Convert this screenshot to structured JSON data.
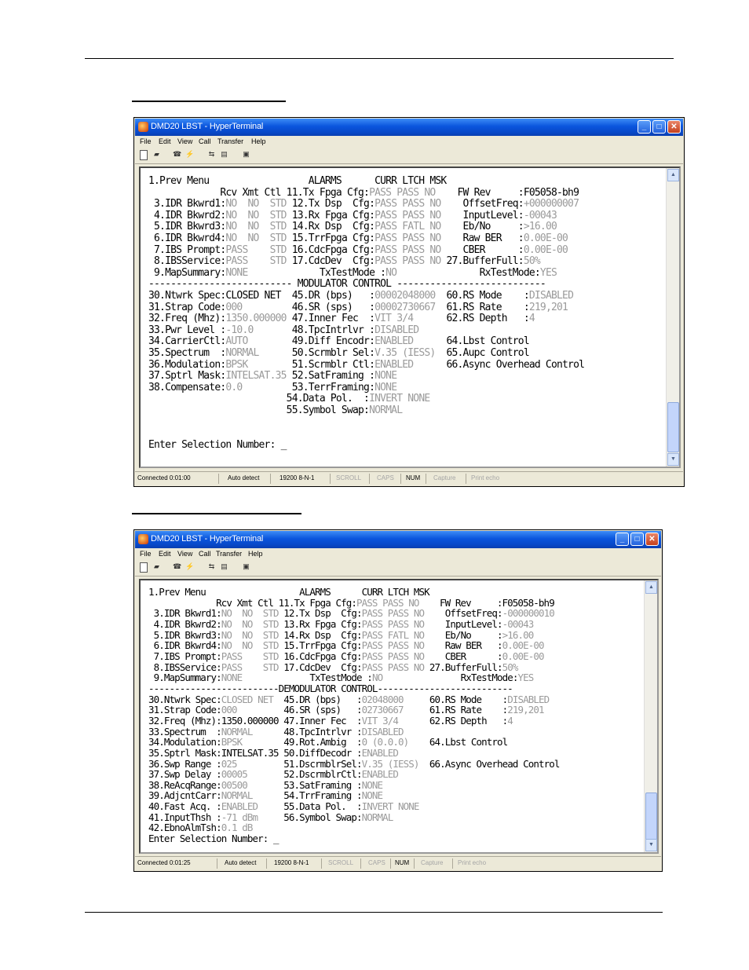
{
  "window1": {
    "title": "DMD20 LBST - HyperTerminal",
    "menu": [
      "File",
      "Edit",
      "View",
      "Call",
      "Transfer",
      "Help"
    ],
    "status": [
      "Connected 0:01:00",
      "Auto detect",
      "19200 8-N-1",
      "SCROLL",
      "CAPS",
      "NUM",
      "Capture",
      "Print echo"
    ],
    "lines": [
      [
        [
          "1.Prev Menu                  ALARMS      CURR LTCH MSK",
          ""
        ]
      ],
      [
        [
          "             Rcv Xmt Ctl 11.Tx Fpga Cfg:",
          ""
        ],
        [
          "PASS PASS NO",
          "d"
        ],
        [
          "    FW Rev     :F05058-bh9",
          ""
        ]
      ],
      [
        [
          " 3.IDR Bkwrd1:",
          ""
        ],
        [
          "NO  NO  STD",
          "d"
        ],
        [
          " 12.Tx Dsp  Cfg:",
          ""
        ],
        [
          "PASS PASS NO",
          "d"
        ],
        [
          "    OffsetFreq:",
          ""
        ],
        [
          "+000000007",
          "d"
        ]
      ],
      [
        [
          " 4.IDR Bkwrd2:",
          ""
        ],
        [
          "NO  NO  STD",
          "d"
        ],
        [
          " 13.Rx Fpga Cfg:",
          ""
        ],
        [
          "PASS PASS NO",
          "d"
        ],
        [
          "    InputLevel:",
          ""
        ],
        [
          "-00043",
          "d"
        ]
      ],
      [
        [
          " 5.IDR Bkwrd3:",
          ""
        ],
        [
          "NO  NO  STD",
          "d"
        ],
        [
          " 14.Rx Dsp  Cfg:",
          ""
        ],
        [
          "PASS FATL NO",
          "d"
        ],
        [
          "    Eb/No     :",
          ""
        ],
        [
          ">16.00",
          "d"
        ]
      ],
      [
        [
          " 6.IDR Bkwrd4:",
          ""
        ],
        [
          "NO  NO  STD",
          "d"
        ],
        [
          " 15.TrrFpga Cfg:",
          ""
        ],
        [
          "PASS PASS NO",
          "d"
        ],
        [
          "    Raw BER   :",
          ""
        ],
        [
          "0.00E-00",
          "d"
        ]
      ],
      [
        [
          " 7.IBS Prompt:",
          ""
        ],
        [
          "PASS    STD",
          "d"
        ],
        [
          " 16.CdcFpga Cfg:",
          ""
        ],
        [
          "PASS PASS NO",
          "d"
        ],
        [
          "    CBER      :",
          ""
        ],
        [
          "0.00E-00",
          "d"
        ]
      ],
      [
        [
          " 8.IBSService:",
          ""
        ],
        [
          "PASS    STD",
          "d"
        ],
        [
          " 17.CdcDev  Cfg:",
          ""
        ],
        [
          "PASS PASS NO",
          "d"
        ],
        [
          " 27.BufferFull:",
          ""
        ],
        [
          "50%",
          "d"
        ]
      ],
      [
        [
          " 9.MapSummary:",
          ""
        ],
        [
          "NONE",
          "d"
        ],
        [
          "             TxTestMode :",
          ""
        ],
        [
          "NO",
          "d"
        ],
        [
          "               RxTestMode:",
          ""
        ],
        [
          "YES",
          "d"
        ]
      ],
      [
        [
          "-------------------------- MODULATOR CONTROL ---------------------------",
          ""
        ]
      ],
      [
        [
          "30.Ntwrk Spec:",
          ""
        ],
        [
          "CLOSED NET",
          ""
        ],
        [
          "  45.DR (bps)   :",
          ""
        ],
        [
          "00002048000",
          "d"
        ],
        [
          "  60.RS Mode    :",
          ""
        ],
        [
          "DISABLED",
          "d"
        ]
      ],
      [
        [
          "31.Strap Code:",
          ""
        ],
        [
          "000",
          "d"
        ],
        [
          "         46.SR (sps)   :",
          ""
        ],
        [
          "00002730667",
          "d"
        ],
        [
          "  61.RS Rate    :",
          ""
        ],
        [
          "219,201",
          "d"
        ]
      ],
      [
        [
          "32.Freq (Mhz):",
          ""
        ],
        [
          "1350.000000",
          "d"
        ],
        [
          " 47.Inner Fec  :",
          ""
        ],
        [
          "VIT 3/4",
          "d"
        ],
        [
          "      62.RS Depth   :",
          ""
        ],
        [
          "4",
          "d"
        ]
      ],
      [
        [
          "33.Pwr Level :",
          ""
        ],
        [
          "-10.0",
          "d"
        ],
        [
          "       48.TpcIntrlvr :",
          ""
        ],
        [
          "DISABLED",
          "d"
        ]
      ],
      [
        [
          "34.CarrierCtl:",
          ""
        ],
        [
          "AUTO",
          "d"
        ],
        [
          "        49.Diff Encodr:",
          ""
        ],
        [
          "ENABLED",
          "d"
        ],
        [
          "      64.Lbst Control",
          ""
        ]
      ],
      [
        [
          "35.Spectrum  :",
          ""
        ],
        [
          "NORMAL",
          "d"
        ],
        [
          "      50.Scrmblr Sel:",
          ""
        ],
        [
          "V.35 (IESS)",
          "d"
        ],
        [
          "  65.Aupc Control",
          ""
        ]
      ],
      [
        [
          "36.Modulation:",
          ""
        ],
        [
          "BPSK",
          "d"
        ],
        [
          "        51.Scrmblr Ctl:",
          ""
        ],
        [
          "ENABLED",
          "d"
        ],
        [
          "      66.Async Overhead Control",
          ""
        ]
      ],
      [
        [
          "37.Sptrl Mask:",
          ""
        ],
        [
          "INTELSAT.35",
          "d"
        ],
        [
          " 52.SatFraming :",
          ""
        ],
        [
          "NONE",
          "d"
        ]
      ],
      [
        [
          "38.Compensate:",
          ""
        ],
        [
          "0.0",
          "d"
        ],
        [
          "         53.TerrFraming:",
          ""
        ],
        [
          "NONE",
          "d"
        ]
      ],
      [
        [
          "                         54.Data Pol.  :",
          ""
        ],
        [
          "INVERT NONE",
          "d"
        ]
      ],
      [
        [
          "                         55.Symbol Swap:",
          ""
        ],
        [
          "NORMAL",
          "d"
        ]
      ],
      [
        [
          "",
          ""
        ]
      ],
      [
        [
          "",
          ""
        ]
      ],
      [
        [
          "Enter Selection Number: _",
          ""
        ]
      ]
    ]
  },
  "window2": {
    "title": "DMD20 LBST - HyperTerminal",
    "menu": [
      "File",
      "Edit",
      "View",
      "Call",
      "Transfer",
      "Help"
    ],
    "status": [
      "Connected 0:01:25",
      "Auto detect",
      "19200 8-N-1",
      "SCROLL",
      "CAPS",
      "NUM",
      "Capture",
      "Print echo"
    ],
    "lines": [
      [
        [
          "1.Prev Menu                  ALARMS      CURR LTCH MSK",
          ""
        ]
      ],
      [
        [
          "             Rcv Xmt Ctl 11.Tx Fpga Cfg:",
          ""
        ],
        [
          "PASS PASS NO",
          "d"
        ],
        [
          "    FW Rev     :F05058-bh9",
          ""
        ]
      ],
      [
        [
          " 3.IDR Bkwrd1:",
          ""
        ],
        [
          "NO  NO  STD",
          "d"
        ],
        [
          " 12.Tx Dsp  Cfg:",
          ""
        ],
        [
          "PASS PASS NO",
          "d"
        ],
        [
          "    OffsetFreq:",
          ""
        ],
        [
          "-000000010",
          "d"
        ]
      ],
      [
        [
          " 4.IDR Bkwrd2:",
          ""
        ],
        [
          "NO  NO  STD",
          "d"
        ],
        [
          " 13.Rx Fpga Cfg:",
          ""
        ],
        [
          "PASS PASS NO",
          "d"
        ],
        [
          "    InputLevel:",
          ""
        ],
        [
          "-00043",
          "d"
        ]
      ],
      [
        [
          " 5.IDR Bkwrd3:",
          ""
        ],
        [
          "NO  NO  STD",
          "d"
        ],
        [
          " 14.Rx Dsp  Cfg:",
          ""
        ],
        [
          "PASS FATL NO",
          "d"
        ],
        [
          "    Eb/No     :",
          ""
        ],
        [
          ">16.00",
          "d"
        ]
      ],
      [
        [
          " 6.IDR Bkwrd4:",
          ""
        ],
        [
          "NO  NO  STD",
          "d"
        ],
        [
          " 15.TrrFpga Cfg:",
          ""
        ],
        [
          "PASS PASS NO",
          "d"
        ],
        [
          "    Raw BER   :",
          ""
        ],
        [
          "0.00E-00",
          "d"
        ]
      ],
      [
        [
          " 7.IBS Prompt:",
          ""
        ],
        [
          "PASS    STD",
          "d"
        ],
        [
          " 16.CdcFpga Cfg:",
          ""
        ],
        [
          "PASS PASS NO",
          "d"
        ],
        [
          "    CBER      :",
          ""
        ],
        [
          "0.00E-00",
          "d"
        ]
      ],
      [
        [
          " 8.IBSService:",
          ""
        ],
        [
          "PASS    STD",
          "d"
        ],
        [
          " 17.CdcDev  Cfg:",
          ""
        ],
        [
          "PASS PASS NO",
          "d"
        ],
        [
          " 27.BufferFull:",
          ""
        ],
        [
          "50%",
          "d"
        ]
      ],
      [
        [
          " 9.MapSummary:",
          ""
        ],
        [
          "NONE",
          "d"
        ],
        [
          "             TxTestMode :",
          ""
        ],
        [
          "NO",
          "d"
        ],
        [
          "               RxTestMode:",
          ""
        ],
        [
          "YES",
          "d"
        ]
      ],
      [
        [
          "-------------------------DEMODULATOR CONTROL--------------------------",
          ""
        ]
      ],
      [
        [
          "30.Ntwrk Spec:",
          ""
        ],
        [
          "CLOSED NET",
          "d"
        ],
        [
          "  45.DR (bps)   :",
          ""
        ],
        [
          "02048000",
          "d"
        ],
        [
          "     60.RS Mode    :",
          ""
        ],
        [
          "DISABLED",
          "d"
        ]
      ],
      [
        [
          "31.Strap Code:",
          ""
        ],
        [
          "000",
          "d"
        ],
        [
          "         46.SR (sps)   :",
          ""
        ],
        [
          "02730667",
          "d"
        ],
        [
          "     61.RS Rate    :",
          ""
        ],
        [
          "219,201",
          "d"
        ]
      ],
      [
        [
          "32.Freq (Mhz):",
          ""
        ],
        [
          "1350.000000",
          ""
        ],
        [
          " 47.Inner Fec  :",
          ""
        ],
        [
          "VIT 3/4",
          "d"
        ],
        [
          "      62.RS Depth   :",
          ""
        ],
        [
          "4",
          "d"
        ]
      ],
      [
        [
          "33.Spectrum  :",
          ""
        ],
        [
          "NORMAL",
          "d"
        ],
        [
          "      48.TpcIntrlvr :",
          ""
        ],
        [
          "DISABLED",
          "d"
        ]
      ],
      [
        [
          "34.Modulation:",
          ""
        ],
        [
          "BPSK",
          "d"
        ],
        [
          "        49.Rot.Ambig  :",
          ""
        ],
        [
          "0 (0.0.0)",
          "d"
        ],
        [
          "    64.Lbst Control",
          ""
        ]
      ],
      [
        [
          "35.Sptrl Mask:",
          ""
        ],
        [
          "INTELSAT.35",
          ""
        ],
        [
          " 50.DiffDecodr :",
          ""
        ],
        [
          "ENABLED",
          "d"
        ]
      ],
      [
        [
          "36.Swp Range :",
          ""
        ],
        [
          "025",
          "d"
        ],
        [
          "         51.DscrmblrSel:",
          ""
        ],
        [
          "V.35 (IESS)",
          "d"
        ],
        [
          "  66.Async Overhead Control",
          ""
        ]
      ],
      [
        [
          "37.Swp Delay :",
          ""
        ],
        [
          "00005",
          "d"
        ],
        [
          "       52.DscrmblrCtl:",
          ""
        ],
        [
          "ENABLED",
          "d"
        ]
      ],
      [
        [
          "38.ReAcqRange:",
          ""
        ],
        [
          "00500",
          "d"
        ],
        [
          "       53.SatFraming :",
          ""
        ],
        [
          "NONE",
          "d"
        ]
      ],
      [
        [
          "39.AdjcntCarr:",
          ""
        ],
        [
          "NORMAL",
          "d"
        ],
        [
          "      54.TrrFraming :",
          ""
        ],
        [
          "NONE",
          "d"
        ]
      ],
      [
        [
          "40.Fast Acq. :",
          ""
        ],
        [
          "ENABLED",
          "d"
        ],
        [
          "     55.Data Pol.  :",
          ""
        ],
        [
          "INVERT NONE",
          "d"
        ]
      ],
      [
        [
          "41.InputThsh :",
          ""
        ],
        [
          "-71 dBm",
          "d"
        ],
        [
          "     56.Symbol Swap:",
          ""
        ],
        [
          "NORMAL",
          "d"
        ]
      ],
      [
        [
          "42.EbnoAlmTsh:",
          ""
        ],
        [
          "0.1 dB",
          "d"
        ]
      ],
      [
        [
          "Enter Selection Number: _",
          ""
        ]
      ]
    ]
  }
}
